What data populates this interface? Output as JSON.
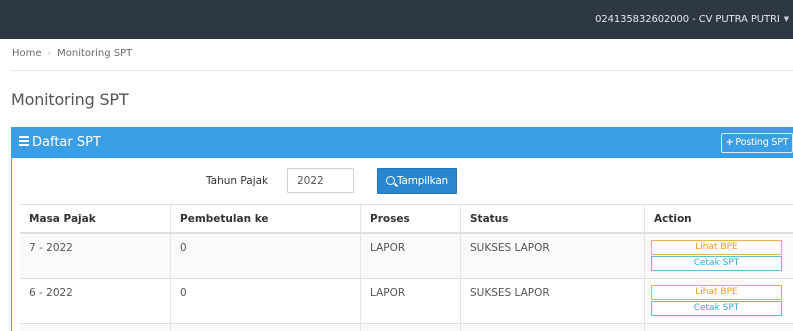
{
  "header": {
    "user_label": "024135832602000 - CV PUTRA PUTRI"
  },
  "breadcrumb": {
    "home": "Home",
    "current": "Monitoring SPT"
  },
  "page": {
    "title": "Monitoring SPT"
  },
  "panel": {
    "title": "Daftar SPT",
    "posting_label": "Posting SPT"
  },
  "filter": {
    "label": "Tahun Pajak",
    "year_value": "2022",
    "submit_label": "Tampilkan"
  },
  "table": {
    "columns": [
      "Masa Pajak",
      "Pembetulan ke",
      "Proses",
      "Status",
      "Action"
    ],
    "rows": [
      {
        "masa": "7 - 2022",
        "pembetulan": "0",
        "proses": "LAPOR",
        "status": "SUKSES LAPOR"
      },
      {
        "masa": "6 - 2022",
        "pembetulan": "0",
        "proses": "LAPOR",
        "status": "SUKSES LAPOR"
      }
    ],
    "actions": {
      "bpe_label": "Lihat BPE",
      "cetak_label": "Cetak SPT"
    }
  },
  "colors": {
    "topbar": "#2d3844",
    "panel_heading": "#3a9ee6",
    "primary_button": "#2a86cf",
    "warning_outline": "#f0ad4e",
    "info_outline": "#5bc0de"
  },
  "icons": {
    "menu": "bars-icon",
    "plus": "plus-icon",
    "search": "search-icon",
    "dropdown": "caret-down-icon"
  }
}
